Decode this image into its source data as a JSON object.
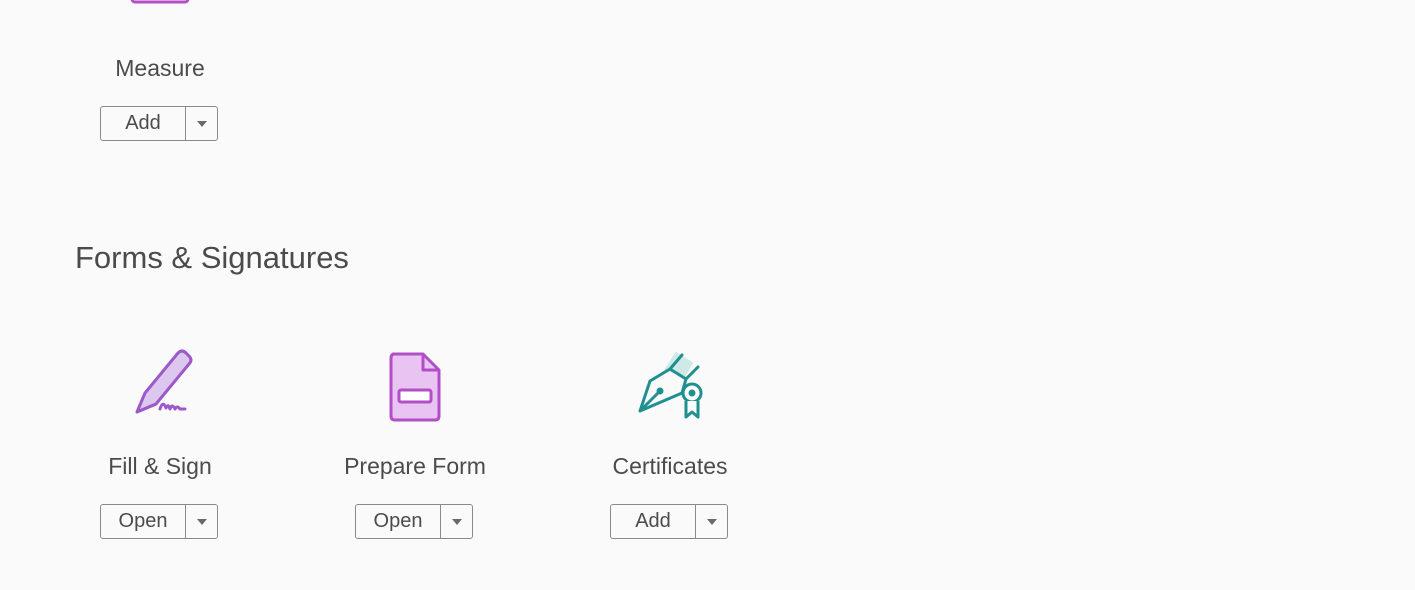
{
  "top_tools": [
    {
      "name": "Measure",
      "button": "Add"
    }
  ],
  "sections": [
    {
      "title": "Forms & Signatures",
      "tools": [
        {
          "name": "Fill & Sign",
          "icon": "fill-sign-icon",
          "button": "Open"
        },
        {
          "name": "Prepare Form",
          "icon": "prepare-form-icon",
          "button": "Open"
        },
        {
          "name": "Certificates",
          "icon": "certificates-icon",
          "button": "Add"
        }
      ]
    }
  ],
  "colors": {
    "purple": "#b24fc6",
    "purple_light": "#e9c3f2",
    "violet": "#9b59c9",
    "violet_light": "#dcc7ef",
    "teal": "#1f8f8f",
    "teal_light": "#cfe9e6"
  }
}
